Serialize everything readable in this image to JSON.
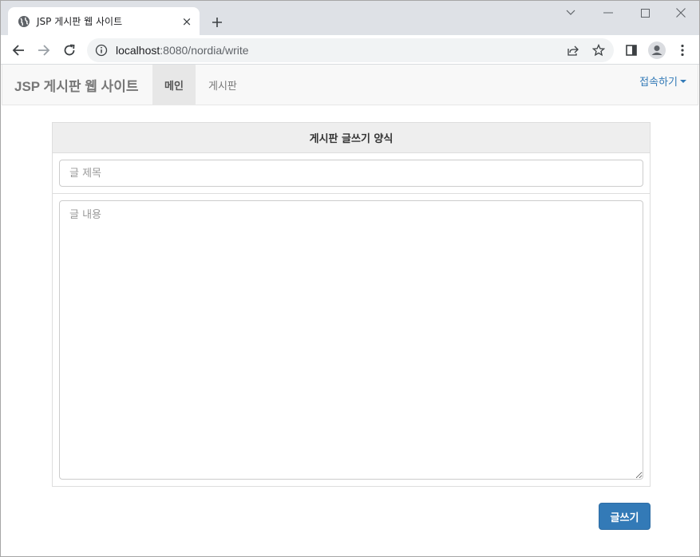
{
  "browser": {
    "tab_title": "JSP 게시판 웹 사이트",
    "tab_close": "×",
    "url_host": "localhost",
    "url_rest": ":8080/nordia/write"
  },
  "navbar": {
    "brand": "JSP 게시판 웹 사이트",
    "items": [
      {
        "label": "메인",
        "active": true
      },
      {
        "label": "게시판",
        "active": false
      }
    ],
    "dropdown_label": "접속하기"
  },
  "form": {
    "heading": "게시판 글쓰기 양식",
    "title_placeholder": "글 제목",
    "content_placeholder": "글 내용",
    "submit_label": "글쓰기"
  },
  "colors": {
    "accent": "#337ab7",
    "navbar_bg": "#f8f8f8",
    "tab_strip": "#dee1e6"
  }
}
